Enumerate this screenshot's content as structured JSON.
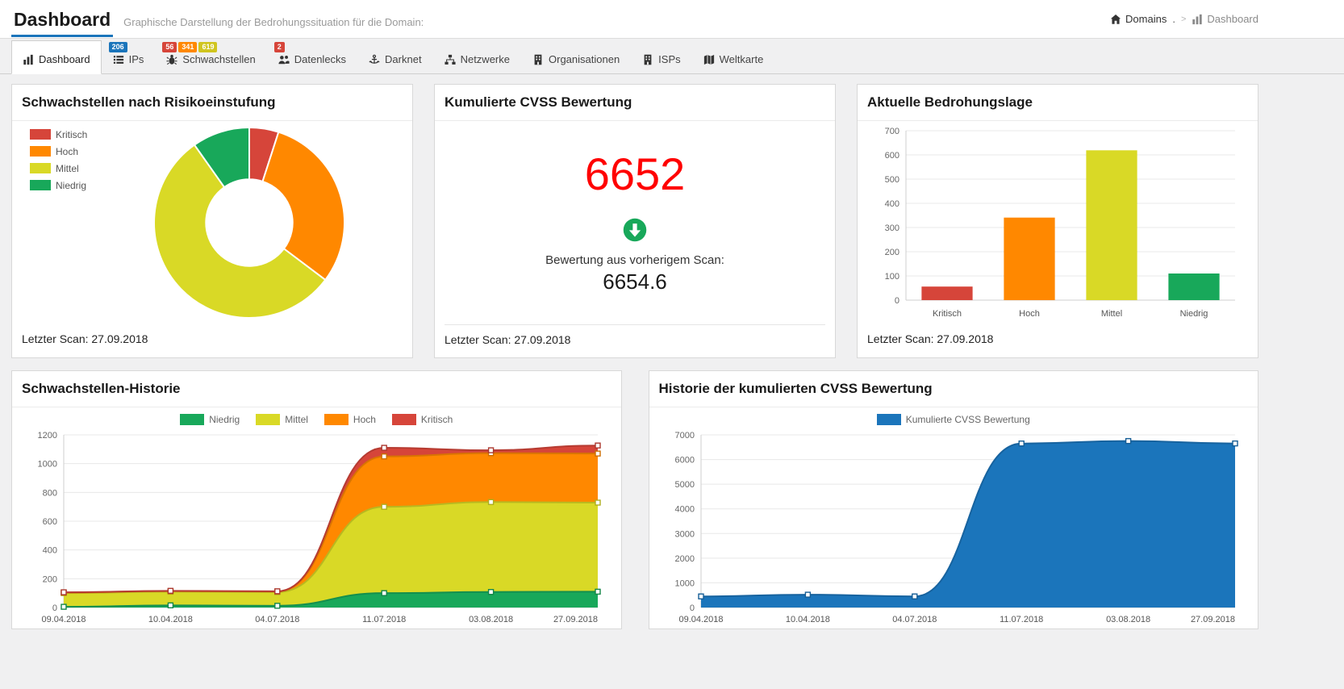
{
  "page": {
    "title": "Dashboard",
    "subtitle": "Graphische Darstellung der Bedrohungssituation für die Domain:",
    "breadcrumb": {
      "domains": "Domains",
      "dot": ".",
      "separator": ">",
      "dashboard": "Dashboard"
    }
  },
  "icons": {
    "home": "home-icon",
    "dashboard": "bar-chart-icon"
  },
  "tabs": [
    {
      "label": "Dashboard",
      "icon": "bar-chart-icon",
      "active": true,
      "badges": []
    },
    {
      "label": "IPs",
      "icon": "list-icon",
      "active": false,
      "badges": [
        {
          "text": "206",
          "color": "#1b75bb"
        }
      ]
    },
    {
      "label": "Schwachstellen",
      "icon": "bug-icon",
      "active": false,
      "badges": [
        {
          "text": "56",
          "color": "#d6453a"
        },
        {
          "text": "341",
          "color": "#ff8800"
        },
        {
          "text": "619",
          "color": "#d0c520"
        }
      ]
    },
    {
      "label": "Datenlecks",
      "icon": "users-icon",
      "active": false,
      "badges": [
        {
          "text": "2",
          "color": "#d6453a"
        }
      ]
    },
    {
      "label": "Darknet",
      "icon": "anchor-icon",
      "active": false,
      "badges": []
    },
    {
      "label": "Netzwerke",
      "icon": "sitemap-icon",
      "active": false,
      "badges": []
    },
    {
      "label": "Organisationen",
      "icon": "building-icon",
      "active": false,
      "badges": []
    },
    {
      "label": "ISPs",
      "icon": "building-icon",
      "active": false,
      "badges": []
    },
    {
      "label": "Weltkarte",
      "icon": "map-icon",
      "active": false,
      "badges": []
    }
  ],
  "cards": {
    "risk": {
      "title": "Schwachstellen nach Risikoeinstufung",
      "footer": "Letzter Scan: 27.09.2018"
    },
    "cvss": {
      "title": "Kumulierte CVSS Bewertung",
      "value": "6652",
      "trend_icon": "arrow-down-circle-icon",
      "previous_label": "Bewertung aus vorherigem Scan:",
      "previous_value": "6654.6",
      "footer": "Letzter Scan: 27.09.2018"
    },
    "threat": {
      "title": "Aktuelle Bedrohungslage",
      "footer": "Letzter Scan: 27.09.2018"
    },
    "history": {
      "title": "Schwachstellen-Historie"
    },
    "cvss_history": {
      "title": "Historie der kumulierten CVSS Bewertung"
    }
  },
  "colors": {
    "accent_blue": "#1b75bb",
    "kritisch_red": "#d6453a",
    "hoch_orange": "#ff8800",
    "mittel_yellow": "#d9d926",
    "niedrig_green": "#18a85a",
    "cvss_value_red": "#ff0000"
  },
  "chart_data": [
    {
      "type": "pie",
      "donut": true,
      "title": "Schwachstellen nach Risikoeinstufung",
      "labels": [
        "Kritisch",
        "Hoch",
        "Mittel",
        "Niedrig"
      ],
      "values": [
        56,
        341,
        619,
        110
      ],
      "colors": [
        "#d6453a",
        "#ff8800",
        "#d9d926",
        "#18a85a"
      ],
      "legend_position": "left"
    },
    {
      "type": "bar",
      "title": "Aktuelle Bedrohungslage",
      "categories": [
        "Kritisch",
        "Hoch",
        "Mittel",
        "Niedrig"
      ],
      "values": [
        56,
        341,
        619,
        110
      ],
      "colors": [
        "#d6453a",
        "#ff8800",
        "#d9d926",
        "#18a85a"
      ],
      "xlabel": "",
      "ylabel": "",
      "ylim": [
        0,
        700
      ],
      "ytick": 100,
      "grid": true
    },
    {
      "type": "area",
      "stacked": true,
      "title": "Schwachstellen-Historie",
      "x": [
        "09.04.2018",
        "10.04.2018",
        "04.07.2018",
        "11.07.2018",
        "03.08.2018",
        "27.09.2018"
      ],
      "series": [
        {
          "name": "Niedrig",
          "color": "#18a85a",
          "values": [
            5,
            15,
            12,
            100,
            108,
            110
          ]
        },
        {
          "name": "Mittel",
          "color": "#d9d926",
          "values": [
            95,
            95,
            95,
            600,
            625,
            619
          ]
        },
        {
          "name": "Hoch",
          "color": "#ff8800",
          "values": [
            4,
            4,
            4,
            350,
            340,
            341
          ]
        },
        {
          "name": "Kritisch",
          "color": "#d6453a",
          "values": [
            2,
            2,
            2,
            60,
            20,
            56
          ]
        }
      ],
      "ylim": [
        0,
        1200
      ],
      "ytick": 200,
      "grid": true,
      "legend_position": "top"
    },
    {
      "type": "area",
      "stacked": false,
      "title": "Historie der kumulierten CVSS Bewertung",
      "x": [
        "09.04.2018",
        "10.04.2018",
        "04.07.2018",
        "11.07.2018",
        "03.08.2018",
        "27.09.2018"
      ],
      "series": [
        {
          "name": "Kumulierte CVSS Bewertung",
          "color": "#1b75bb",
          "values": [
            450,
            520,
            450,
            6650,
            6750,
            6652
          ]
        }
      ],
      "ylim": [
        0,
        7000
      ],
      "ytick": 1000,
      "grid": true,
      "legend_position": "top"
    }
  ]
}
